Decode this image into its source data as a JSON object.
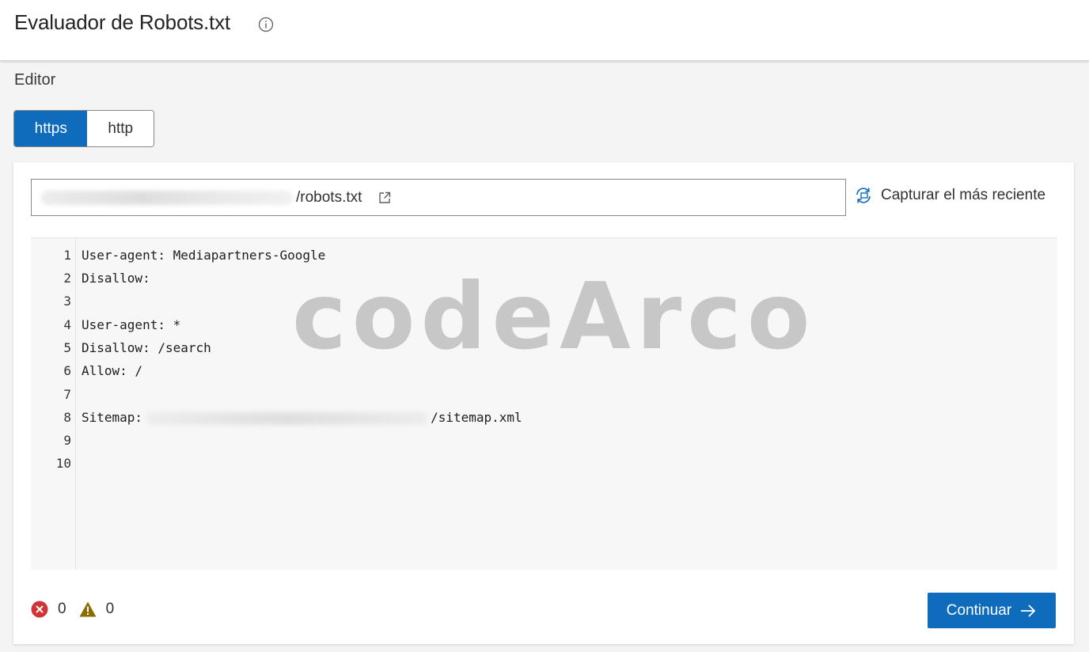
{
  "header": {
    "title": "Evaluador de Robots.txt",
    "info_icon": "info-circle-icon"
  },
  "editor_section": {
    "title": "Editor",
    "protocol_tabs": [
      {
        "label": "https",
        "selected": true
      },
      {
        "label": "http",
        "selected": false
      }
    ],
    "url": {
      "suffix": "/robots.txt",
      "open_icon": "external-link-icon"
    },
    "capture": {
      "label": "Capturar el más reciente",
      "icon": "refresh-capture-icon"
    },
    "code_lines": [
      {
        "num": "1",
        "text": "User-agent: Mediapartners-Google"
      },
      {
        "num": "2",
        "text": "Disallow:"
      },
      {
        "num": "3",
        "text": ""
      },
      {
        "num": "4",
        "text": "User-agent: *"
      },
      {
        "num": "5",
        "text": "Disallow: /search"
      },
      {
        "num": "6",
        "text": "Allow: /"
      },
      {
        "num": "7",
        "text": ""
      },
      {
        "num": "8",
        "text": "Sitemap:",
        "suffix": "/sitemap.xml"
      },
      {
        "num": "9",
        "text": ""
      },
      {
        "num": "10",
        "text": ""
      }
    ],
    "watermark": "codeArco"
  },
  "footer": {
    "errors": "0",
    "warnings": "0",
    "continue_label": "Continuar"
  },
  "colors": {
    "accent": "#0f6cbd",
    "error": "#d13438",
    "warning": "#8a6d00"
  }
}
